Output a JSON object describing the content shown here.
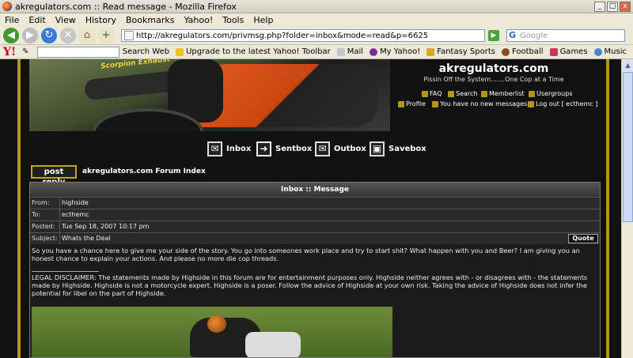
{
  "browser": {
    "window_title": "akregulators.com :: Read message - Mozilla Firefox",
    "menus": [
      "File",
      "Edit",
      "View",
      "History",
      "Bookmarks",
      "Yahoo!",
      "Tools",
      "Help"
    ],
    "url": "http://akregulators.com/privmsg.php?folder=inbox&mode=read&p=6625",
    "search_placeholder": "Google"
  },
  "yahoo_toolbar": {
    "logo": "Y!",
    "search_web": "Search Web",
    "upgrade": "Upgrade to the latest Yahoo! Toolbar",
    "mail": "Mail",
    "my_yahoo": "My Yahoo!",
    "fantasy": "Fantasy Sports",
    "football": "Football",
    "games": "Games",
    "music": "Music"
  },
  "site": {
    "name": "akregulators.com",
    "tagline": "Pissin Off the System.......One Cop at a Time",
    "banner_text": "Scorpion Exhaust",
    "links": {
      "faq": "FAQ",
      "search": "Search",
      "memberlist": "Memberlist",
      "usergroups": "Usergroups",
      "profile": "Profile",
      "messages": "You have no new messages",
      "logout": "Log out [ ecthemc ]"
    }
  },
  "pm_nav": {
    "inbox": "Inbox",
    "sentbox": "Sentbox",
    "outbox": "Outbox",
    "savebox": "Savebox"
  },
  "post_reply": "post reply",
  "forum_index": "akregulators.com Forum Index",
  "message": {
    "header": "Inbox :: Message",
    "from_label": "From:",
    "from": "highside",
    "to_label": "To:",
    "to": "ecthemc",
    "posted_label": "Posted:",
    "posted": "Tue Sep 18, 2007 10:17 pm",
    "subject_label": "Subject:",
    "subject": "Whats the Deal",
    "quote": "Quote",
    "body": "So you have a chance here to give me your side of the story. You go into someones work place and try to start shit? What happen with you and Beer? I am giving you an honest chance to explain your actions. And please no more die cop threads.",
    "signature": "LEGAL DISCLAIMER: The statements made by Highside in this forum are for entertainment purposes only. Highside neither agrees with - or disagrees with - the statements made by Highside. Highside is not a motorcycle expert, Highside is a poser. Follow the advice of Highside at your own risk. Taking the advice of Highside does not infer the potential for libel on the part of Highside."
  }
}
